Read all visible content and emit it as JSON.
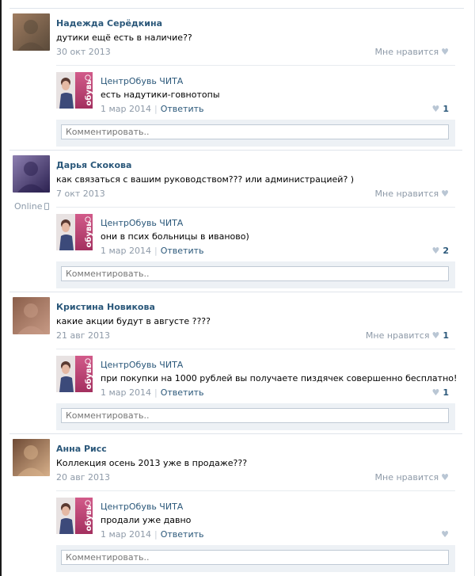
{
  "comment_placeholder": "Комментировать..",
  "posts": [
    {
      "author": "Надежда Серёдкина",
      "text": "дутики ещё есть в наличие??",
      "date": "30 окт 2013",
      "like_label": "Мне нравится",
      "like_count": "",
      "online": "",
      "avatar_colors": [
        "#5a4a3a",
        "#a07d61"
      ],
      "reply": {
        "author": "ЦентрОбувь ЧИТА",
        "text": "есть надутики-говнотопы",
        "date": "1 мар 2014",
        "answer": "Ответить",
        "like_count": "1"
      }
    },
    {
      "author": "Дарья Скокова",
      "text": "как связаться с вашим руководством??? или администрацией? )",
      "date": "7 окт 2013",
      "like_label": "Мне нравится",
      "like_count": "",
      "online": "Online",
      "avatar_colors": [
        "#2b2150",
        "#8d7fb0"
      ],
      "reply": {
        "author": "ЦентрОбувь ЧИТА",
        "text": "они в псих больницы в иваново)",
        "date": "1 мар 2014",
        "answer": "Ответить",
        "like_count": "2"
      }
    },
    {
      "author": "Кристина Новикова",
      "text": "какие акции будут в августе ????",
      "date": "21 авг 2013",
      "like_label": "Мне нравится",
      "like_count": "1",
      "online": "",
      "avatar_colors": [
        "#c79a85",
        "#8a5e4a"
      ],
      "reply": {
        "author": "ЦентрОбувь ЧИТА",
        "text": "при покупки на 1000 рублей вы получаете пиздячек совершенно бесплатно!",
        "date": "1 мар 2014",
        "answer": "Ответить",
        "like_count": "1"
      }
    },
    {
      "author": "Анна Рисс",
      "text": "Коллекция осень 2013 уже в продаже???",
      "date": "20 авг 2013",
      "like_label": "Мне нравится",
      "like_count": "",
      "online": "",
      "avatar_colors": [
        "#d7b08a",
        "#6e4a35"
      ],
      "reply": {
        "author": "ЦентрОбувь ЧИТА",
        "text": "продали уже давно",
        "date": "1 мар 2014",
        "answer": "Ответить",
        "like_count": ""
      }
    }
  ],
  "brand_logo": {
    "label": "обувь",
    "colors": [
      "#c94b7b",
      "#9d2a58"
    ]
  }
}
